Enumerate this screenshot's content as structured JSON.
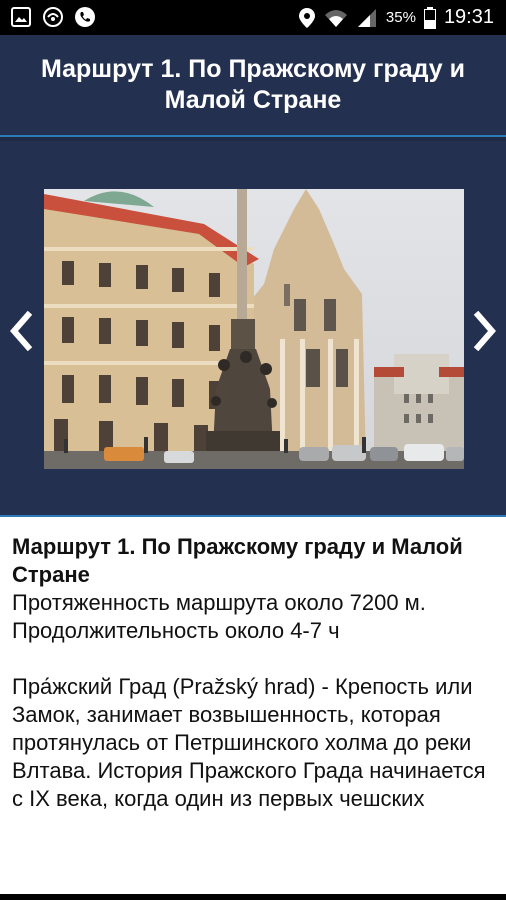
{
  "status_bar": {
    "battery_pct": "35%",
    "time": "19:31"
  },
  "header": {
    "title": "Маршрут 1. По Пражскому граду и Малой Стране"
  },
  "gallery": {
    "photo_icon": "prague-church-photo",
    "prev_icon": "chevron-left-icon",
    "next_icon": "chevron-right-icon"
  },
  "article": {
    "title": "Маршрут 1. По Пражскому граду и Малой Стране",
    "length": "Протяженность маршрута около 7200 м.",
    "duration": "Продолжительность около 4-7 ч",
    "body": "Пра́жский Град (Pražský hrad) - Крепость или Замок, занимает возвышенность, которая протянулась от Петршинского холма до реки Влтава. История Пражского Града начинается с IX века, когда один из первых чешских"
  },
  "colors": {
    "header_bg": "#243050",
    "divider": "#2e7ab8",
    "article_bg": "#ffffff"
  }
}
